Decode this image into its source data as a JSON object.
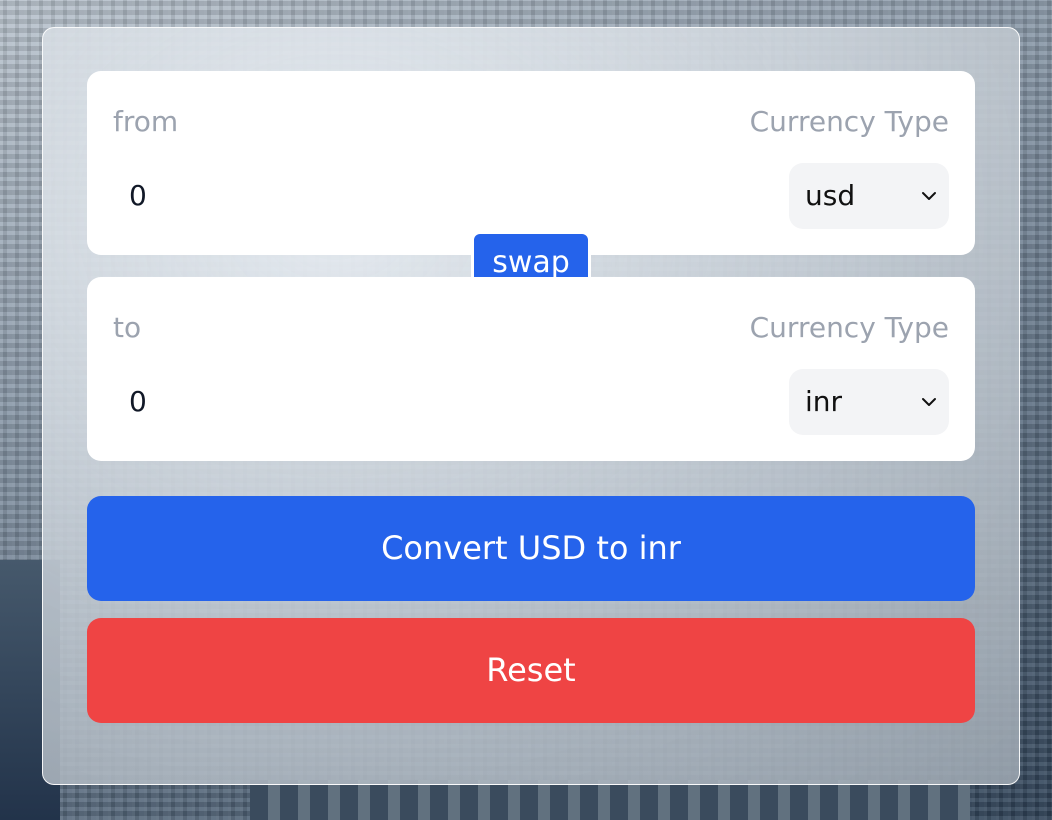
{
  "from": {
    "label": "from",
    "currency_type_label": "Currency Type",
    "amount": "0",
    "currency": "usd"
  },
  "to": {
    "label": "to",
    "currency_type_label": "Currency Type",
    "amount": "0",
    "currency": "inr"
  },
  "swap_label": "swap",
  "convert_label": "Convert USD to inr",
  "reset_label": "Reset",
  "colors": {
    "primary": "#2563eb",
    "danger": "#ef4444",
    "panel": "#ffffff",
    "select_bg": "#f3f4f6",
    "muted_text": "#9ca3af"
  },
  "icons": {
    "select_arrow": "chevron-down-icon"
  }
}
